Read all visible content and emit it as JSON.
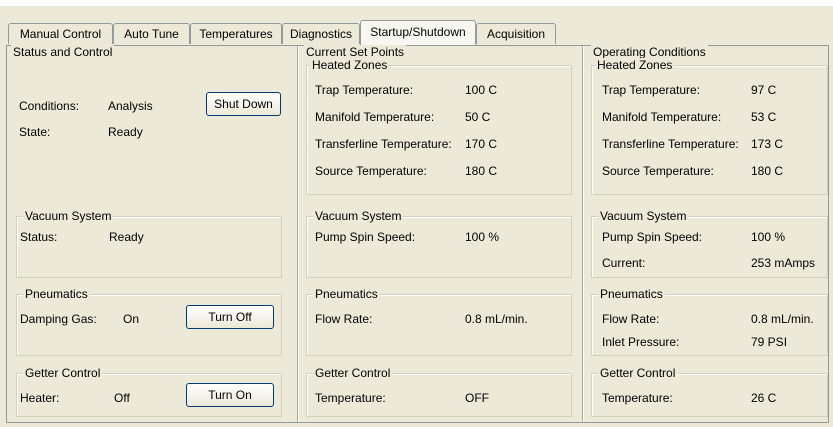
{
  "tabs": [
    "Manual Control",
    "Auto Tune",
    "Temperatures",
    "Diagnostics",
    "Startup/Shutdown",
    "Acquisition"
  ],
  "active_tab": "Startup/Shutdown",
  "status_and_control": {
    "title": "Status and Control",
    "conditions_label": "Conditions:",
    "conditions_value": "Analysis",
    "shutdown_button": "Shut Down",
    "state_label": "State:",
    "state_value": "Ready",
    "vacuum": {
      "title": "Vacuum System",
      "status_label": "Status:",
      "status_value": "Ready"
    },
    "pneumatics": {
      "title": "Pneumatics",
      "damping_label": "Damping Gas:",
      "damping_value": "On",
      "turn_off_button": "Turn Off"
    },
    "getter": {
      "title": "Getter Control",
      "heater_label": "Heater:",
      "heater_value": "Off",
      "turn_on_button": "Turn On"
    }
  },
  "set_points": {
    "title": "Current Set Points",
    "heated_zones": {
      "title": "Heated Zones",
      "trap_label": "Trap Temperature:",
      "trap_value": "100 C",
      "manifold_label": "Manifold Temperature:",
      "manifold_value": "50 C",
      "transfer_label": "Transferline Temperature:",
      "transfer_value": "170 C",
      "source_label": "Source Temperature:",
      "source_value": "180 C"
    },
    "vacuum": {
      "title": "Vacuum System",
      "pump_label": "Pump Spin Speed:",
      "pump_value": "100 %"
    },
    "pneumatics": {
      "title": "Pneumatics",
      "flow_label": "Flow Rate:",
      "flow_value": "0.8 mL/min."
    },
    "getter": {
      "title": "Getter Control",
      "temp_label": "Temperature:",
      "temp_value": "OFF"
    }
  },
  "operating": {
    "title": "Operating Conditions",
    "heated_zones": {
      "title": "Heated Zones",
      "trap_label": "Trap Temperature:",
      "trap_value": "97 C",
      "manifold_label": "Manifold Temperature:",
      "manifold_value": "53 C",
      "transfer_label": "Transferline Temperature:",
      "transfer_value": "173 C",
      "source_label": "Source Temperature:",
      "source_value": "180 C"
    },
    "vacuum": {
      "title": "Vacuum System",
      "pump_label": "Pump Spin Speed:",
      "pump_value": "100 %",
      "current_label": "Current:",
      "current_value": "253 mAmps"
    },
    "pneumatics": {
      "title": "Pneumatics",
      "flow_label": "Flow Rate:",
      "flow_value": "0.8 mL/min.",
      "inlet_label": "Inlet Pressure:",
      "inlet_value": "79 PSI"
    },
    "getter": {
      "title": "Getter Control",
      "temp_label": "Temperature:",
      "temp_value": "26 C"
    }
  }
}
